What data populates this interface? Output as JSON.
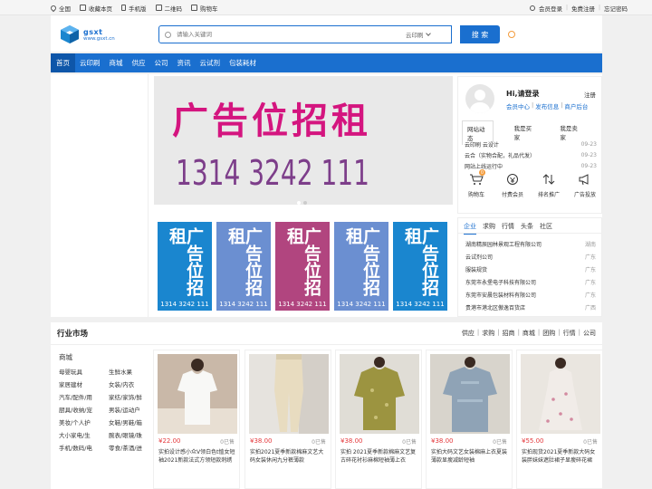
{
  "topbar": {
    "left": [
      {
        "label": "全国",
        "icon": "location-icon"
      },
      {
        "label": "收藏本页",
        "icon": "bookmark-icon"
      },
      {
        "label": "手机版",
        "icon": "mobile-icon"
      },
      {
        "label": "二维码",
        "icon": "qrcode-icon"
      },
      {
        "label": "购物车",
        "icon": "cart-icon"
      }
    ],
    "right": {
      "login": "会员登录",
      "register": "免费注册",
      "forgot": "忘记密码"
    }
  },
  "header": {
    "logo_text": "gsxt",
    "logo_url_text": "www.gsxt.cn",
    "search_placeholder": "请输入关键词",
    "search_scope": "云印刷",
    "search_button": "搜 索"
  },
  "nav": [
    "首页",
    "云印刷",
    "商城",
    "供应",
    "公司",
    "资讯",
    "云试剂",
    "包装耗材"
  ],
  "banner": {
    "text1": "广告位招租",
    "text2": "1314 3242 111"
  },
  "tiles": [
    {
      "text": "广告位招租",
      "num": "1314 3242 111",
      "color": "#1a86cf"
    },
    {
      "text": "广告位招租",
      "num": "1314 3242 111",
      "color": "#6b8fd1"
    },
    {
      "text": "广告位招租",
      "num": "1314 3242 111",
      "color": "#b1457f"
    },
    {
      "text": "广告位招租",
      "num": "1314 3242 111",
      "color": "#6b8fd1"
    },
    {
      "text": "广告位招租",
      "num": "1314 3242 111",
      "color": "#1a86cf"
    }
  ],
  "user": {
    "greeting": "Hi,请登录",
    "register": "注册",
    "links": [
      "会员中心",
      "发布信息",
      "商户后台"
    ],
    "tabs": [
      "网站动态",
      "我是买家",
      "我是卖家"
    ],
    "news": [
      {
        "title": "云印刷 云设计",
        "date": "09-23"
      },
      {
        "title": "云合（实物合配，礼品代发）",
        "date": "09-23"
      },
      {
        "title": "网站上线运行中",
        "date": "09-23"
      }
    ],
    "icons": [
      {
        "label": "购物车",
        "icon": "cart-icon",
        "badge": "0"
      },
      {
        "label": "付费会员",
        "icon": "member-icon"
      },
      {
        "label": "排名推广",
        "icon": "rank-icon"
      },
      {
        "label": "广告投放",
        "icon": "ad-icon"
      }
    ]
  },
  "companies": {
    "tabs": [
      "企业",
      "求购",
      "行情",
      "头条",
      "社区"
    ],
    "list": [
      {
        "name": "湖南精辰园林景观工程有限公司",
        "region": "湖南"
      },
      {
        "name": "云试剂公司",
        "region": "广东"
      },
      {
        "name": "服装规货",
        "region": "广东"
      },
      {
        "name": "东莞市永堡电子科技有限公司",
        "region": "广东"
      },
      {
        "name": "东莞市安晨包装材料有限公司",
        "region": "广东"
      },
      {
        "name": "贵港市港北区傲逸百货店",
        "region": "广西"
      }
    ]
  },
  "market": {
    "title": "行业市场",
    "links": [
      "供应",
      "求购",
      "招商",
      "商城",
      "团购",
      "行情",
      "公司"
    ],
    "category_head": "商城",
    "categories": [
      "母婴玩具",
      "生鲜水果",
      "家居建材",
      "女装/内衣",
      "汽车/配件/用",
      "家纺/家饰/鲜",
      "厨具/收纳/宠",
      "男装/运动户",
      "美妆/个人护",
      "女鞋/男鞋/箱",
      "大小家电/生",
      "腕表/眼镜/珠",
      "手机/数码/电",
      "零食/茶酒/进"
    ],
    "products": [
      {
        "price": "¥22.00",
        "sold": "0已售",
        "name": "实拍设计感小众V领白色t恤女短袖2021新款法式方领短款刺绣"
      },
      {
        "price": "¥38.00",
        "sold": "0已售",
        "name": "实拍2021夏季新款棉麻文艺大码女装休闲九分裤薄款"
      },
      {
        "price": "¥38.00",
        "sold": "0已售",
        "name": "实拍 2021夏季新款棉麻文艺复古碎花衬衫麻棉短袖薄上衣"
      },
      {
        "price": "¥38.00",
        "sold": "0已售",
        "name": "实拍大码文艺女装棉麻上衣夏装薄款显瘦减龄短袖"
      },
      {
        "price": "¥55.00",
        "sold": "0已售",
        "name": "实拍现货2021夏季新款大码女装胖妹妹遮肚裙子显瘦碎花裙"
      }
    ]
  }
}
